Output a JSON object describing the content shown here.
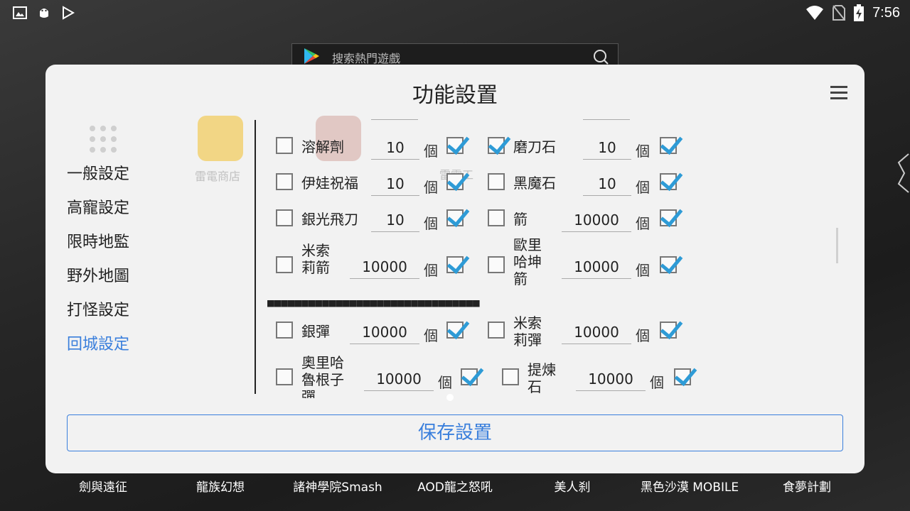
{
  "status_bar": {
    "time": "7:56",
    "left_icons": [
      "image-icon",
      "android-icon",
      "play-store-icon"
    ],
    "right_icons": [
      "wifi-icon",
      "no-sim-icon",
      "battery-charging-icon"
    ]
  },
  "background": {
    "search_placeholder": "搜索熱門遊戲",
    "apps": [
      {
        "label": "劍與遠征",
        "color": "#3b6fb8"
      },
      {
        "label": "龍族幻想",
        "color": "#6b5a8e"
      },
      {
        "label": "諸神學院Smash",
        "color": "#caa96a"
      },
      {
        "label": "AOD龍之怒吼",
        "color": "#7a3b2a"
      },
      {
        "label": "美人刹",
        "color": "#8e2f3a"
      },
      {
        "label": "黑色沙漠 MOBILE",
        "color": "#4a6b8a"
      },
      {
        "label": "食夢計劃",
        "color": "#b08a6a"
      }
    ],
    "ghost_store_label": "雷電商店",
    "ghost_tool_label": "雷電工"
  },
  "dialog": {
    "title": "功能設置",
    "save_label": "保存設置",
    "nav": [
      {
        "label": "一般設定",
        "active": false
      },
      {
        "label": "高寵設定",
        "active": false
      },
      {
        "label": "限時地監",
        "active": false
      },
      {
        "label": "野外地圖",
        "active": false
      },
      {
        "label": "打怪設定",
        "active": false
      },
      {
        "label": "回城設定",
        "active": true
      }
    ],
    "separator": "■■■■■■■■■■■■■■■■■■■■■■■■■■■■■■■",
    "unit": "個",
    "accent_color": "#3a7fdc",
    "check_color": "#2e9bd6",
    "items": [
      {
        "left": {
          "name": "溶解劑",
          "value": "10",
          "checked": false,
          "enabled": true
        },
        "right": {
          "name": "磨刀石",
          "value": "10",
          "checked": true,
          "enabled": true
        }
      },
      {
        "left": {
          "name": "伊娃祝福",
          "value": "10",
          "checked": false,
          "enabled": true
        },
        "right": {
          "name": "黑魔石",
          "value": "10",
          "checked": false,
          "enabled": true
        }
      },
      {
        "left": {
          "name": "銀光飛刀",
          "value": "10",
          "checked": false,
          "enabled": true
        },
        "right": {
          "name": "箭",
          "value": "10000",
          "checked": false,
          "enabled": true
        }
      },
      {
        "left": {
          "name": "米索莉箭",
          "value": "10000",
          "checked": false,
          "enabled": true
        },
        "right": {
          "name": "歐里哈坤箭",
          "value": "10000",
          "checked": false,
          "enabled": true
        }
      },
      {
        "left": {
          "name": "銀彈",
          "value": "10000",
          "checked": false,
          "enabled": true
        },
        "right": {
          "name": "米索莉彈",
          "value": "10000",
          "checked": false,
          "enabled": true
        }
      },
      {
        "left": {
          "name": "奧里哈魯根子彈",
          "value": "10000",
          "checked": false,
          "enabled": true
        },
        "right": {
          "name": "提煉石",
          "value": "10000",
          "checked": false,
          "enabled": true
        }
      }
    ]
  }
}
